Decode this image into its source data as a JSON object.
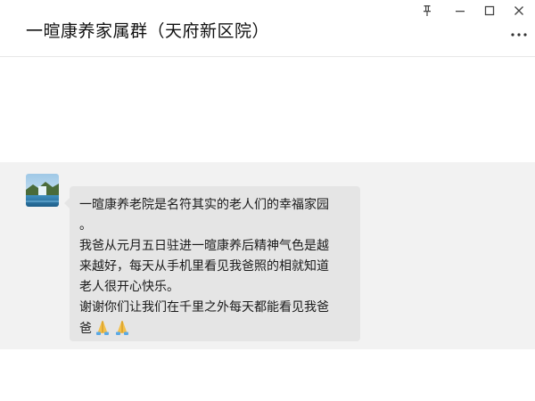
{
  "window": {
    "title": "一暄康养家属群（天府新区院）",
    "controls": {
      "pin_icon": "pin-icon",
      "minimize_icon": "minimize-icon",
      "maximize_icon": "maximize-icon",
      "close_icon": "close-icon",
      "more_icon": "more-icon"
    }
  },
  "message": {
    "avatar_icon": "landscape-avatar",
    "lines": [
      "一暄康养老院是名符其实的老人们的幸福家园",
      "。",
      "我爸从元月五日驻进一暄康养后精神气色是越",
      "来越好，每天从手机里看见我爸照的相就知道",
      "老人很开心快乐。",
      "谢谢你们让我们在千里之外每天都能看见我爸",
      "爸"
    ],
    "trailing_emojis": [
      "folded-hands-emoji",
      "folded-hands-emoji"
    ]
  },
  "colors": {
    "band": "#f2f2f2",
    "bubble": "#e5e5e5",
    "text": "#1a1a1a"
  }
}
